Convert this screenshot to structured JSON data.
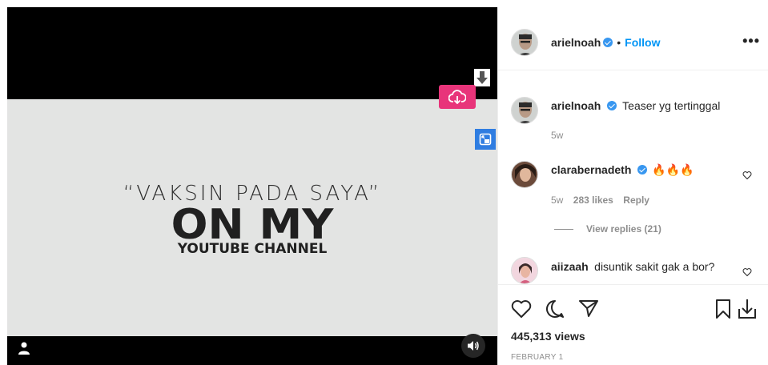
{
  "video": {
    "line1": "“VAKSIN PADA SAYA”",
    "line2": "ON MY",
    "line3": "YOUTUBE CHANNEL"
  },
  "post": {
    "author": "arielnoah",
    "separator": "•",
    "follow_label": "Follow",
    "more_label": "•••"
  },
  "caption": {
    "author": "arielnoah",
    "text": "Teaser yg tertinggal",
    "age": "5w"
  },
  "comments": [
    {
      "author": "clarabernadeth",
      "text": "🔥🔥🔥",
      "age": "5w",
      "likes": "283 likes",
      "reply_label": "Reply",
      "view_replies": "View replies (21)"
    },
    {
      "author": "aiizaah",
      "text": "disuntik sakit gak a bor?"
    }
  ],
  "stats": {
    "views": "445,313 views",
    "date": "FEBRUARY 1"
  },
  "colors": {
    "download_button": "#e8347a",
    "pip_button": "#2f7de1",
    "follow": "#0095f6",
    "verified": "#3897f0"
  }
}
